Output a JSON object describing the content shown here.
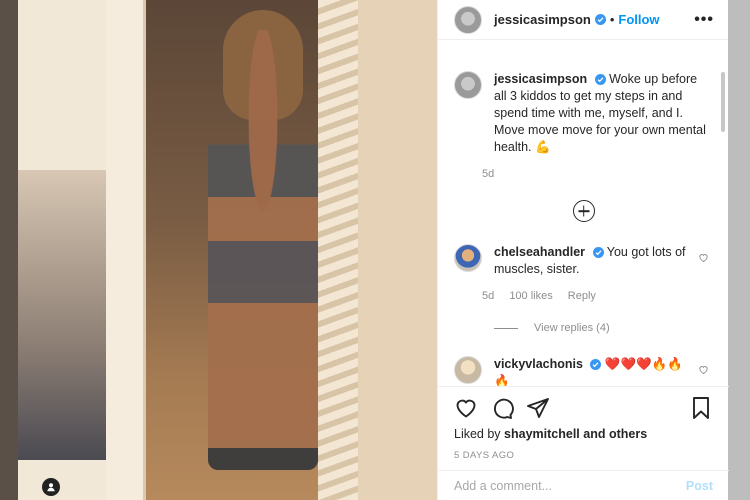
{
  "header": {
    "username": "jessicasimpson",
    "separator": "•",
    "follow_label": "Follow",
    "more_label": "•••"
  },
  "caption": {
    "username": "jessicasimpson",
    "text": "Woke up before all 3 kiddos to get my steps in and spend time with me, myself, and I. Move move move for your own mental health. 💪",
    "age": "5d"
  },
  "comments": [
    {
      "username": "chelseahandler",
      "text": "You got lots of muscles, sister.",
      "age": "5d",
      "likes": "100 likes",
      "reply_label": "Reply",
      "view_replies": "View replies (4)"
    },
    {
      "username": "vickyvlachonis",
      "text": "❤️❤️❤️🔥🔥",
      "text_overflow": "🔥"
    }
  ],
  "likes": {
    "prefix": "Liked by",
    "user": "shaymitchell",
    "suffix": "and others"
  },
  "date": "5 DAYS AGO",
  "add_comment": {
    "placeholder": "Add a comment...",
    "post_label": "Post"
  },
  "icons": [
    "heart-icon",
    "comment-icon",
    "share-icon",
    "bookmark-icon",
    "verified-icon",
    "load-more-icon",
    "user-tag-icon"
  ],
  "colors": {
    "link_blue": "#0095f6",
    "post_disabled": "#b2dffc",
    "text": "#262626",
    "muted": "#8e8e8e",
    "verified": "#3897f0"
  }
}
